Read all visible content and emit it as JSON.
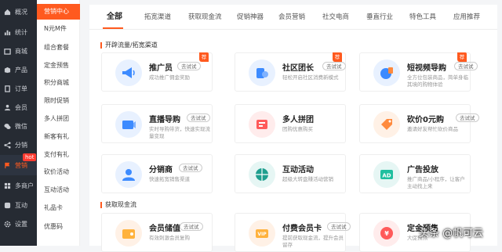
{
  "sidebar": {
    "items": [
      {
        "label": "概况",
        "icon": "home-icon"
      },
      {
        "label": "统计",
        "icon": "stats-icon"
      },
      {
        "label": "商城",
        "icon": "shop-icon"
      },
      {
        "label": "产品",
        "icon": "product-icon"
      },
      {
        "label": "订单",
        "icon": "order-icon"
      },
      {
        "label": "会员",
        "icon": "member-icon"
      },
      {
        "label": "微信",
        "icon": "wechat-icon"
      },
      {
        "label": "分销",
        "icon": "share-icon"
      },
      {
        "label": "营销",
        "icon": "flag-icon"
      },
      {
        "label": "多商户",
        "icon": "merchant-icon"
      },
      {
        "label": "互动",
        "icon": "interact-icon"
      },
      {
        "label": "设置",
        "icon": "settings-icon"
      }
    ],
    "hot_badge": "hot",
    "active_color": "#ff5a1f"
  },
  "submenu": {
    "items": [
      "营销中心",
      "N元M件",
      "组合套餐",
      "定金预售",
      "积分商城",
      "限时促销",
      "多人拼团",
      "新客有礼",
      "支付有礼",
      "砍价活动",
      "互动活动",
      "礼品卡",
      "优惠码"
    ]
  },
  "tabs": [
    "全部",
    "拓宽渠道",
    "获取现金流",
    "促销神器",
    "会员营销",
    "社交电商",
    "垂直行业",
    "特色工具",
    "应用推荐"
  ],
  "sections": {
    "channel_title": "开辟流量/拓宽渠道",
    "cash_title": "获取现金流"
  },
  "try_label": "去试试",
  "cards": [
    {
      "title": "推广员",
      "desc": "成功推广佣金奖励",
      "badge": "荐",
      "icon": "megaphone-icon",
      "bg": "#e8f1ff"
    },
    {
      "title": "社区团长",
      "desc": "轻松开启社区消费新模式",
      "badge": "荐",
      "icon": "leader-icon",
      "bg": "#e8f1ff"
    },
    {
      "title": "短视频导购",
      "desc": "全方位包装商品，简单身临其境的购物体验",
      "badge": "荐",
      "icon": "video-icon",
      "bg": "#e8f1ff"
    },
    {
      "title": "直播导购",
      "desc": "实时导购带货，快速实现流量变现",
      "icon": "live-icon",
      "bg": "#e8f1ff"
    },
    {
      "title": "多人拼团",
      "desc": "团购优惠购买",
      "icon": "group-icon",
      "bg": "#ffecec"
    },
    {
      "title": "砍价0元购",
      "desc": "邀请好友帮忙砍价商品",
      "icon": "bargain-icon",
      "bg": "#fff1e6"
    },
    {
      "title": "分销商",
      "desc": "快速拓宽销售渠道",
      "icon": "distributor-icon",
      "bg": "#e8f1ff"
    },
    {
      "title": "互动活动",
      "desc": "超级大转盘赚活动营销",
      "icon": "interactive-icon",
      "bg": "#e6f6f4"
    },
    {
      "title": "广告投放",
      "desc": "推广商品/小程序，让客户主动找上来",
      "icon": "ad-icon",
      "bg": "#e6f6f4"
    },
    {
      "title": "会员储值",
      "desc": "有效刺激会员复购",
      "icon": "wallet-icon",
      "bg": "#fff1e6"
    },
    {
      "title": "付费会员卡",
      "desc": "提前获取现金流，提升会员留存",
      "icon": "vip-icon",
      "bg": "#fff1e6"
    },
    {
      "title": "定金预售",
      "desc": "大促预热",
      "icon": "presale-icon",
      "bg": "#ffecec"
    }
  ],
  "watermark": "头条 @帆可云"
}
